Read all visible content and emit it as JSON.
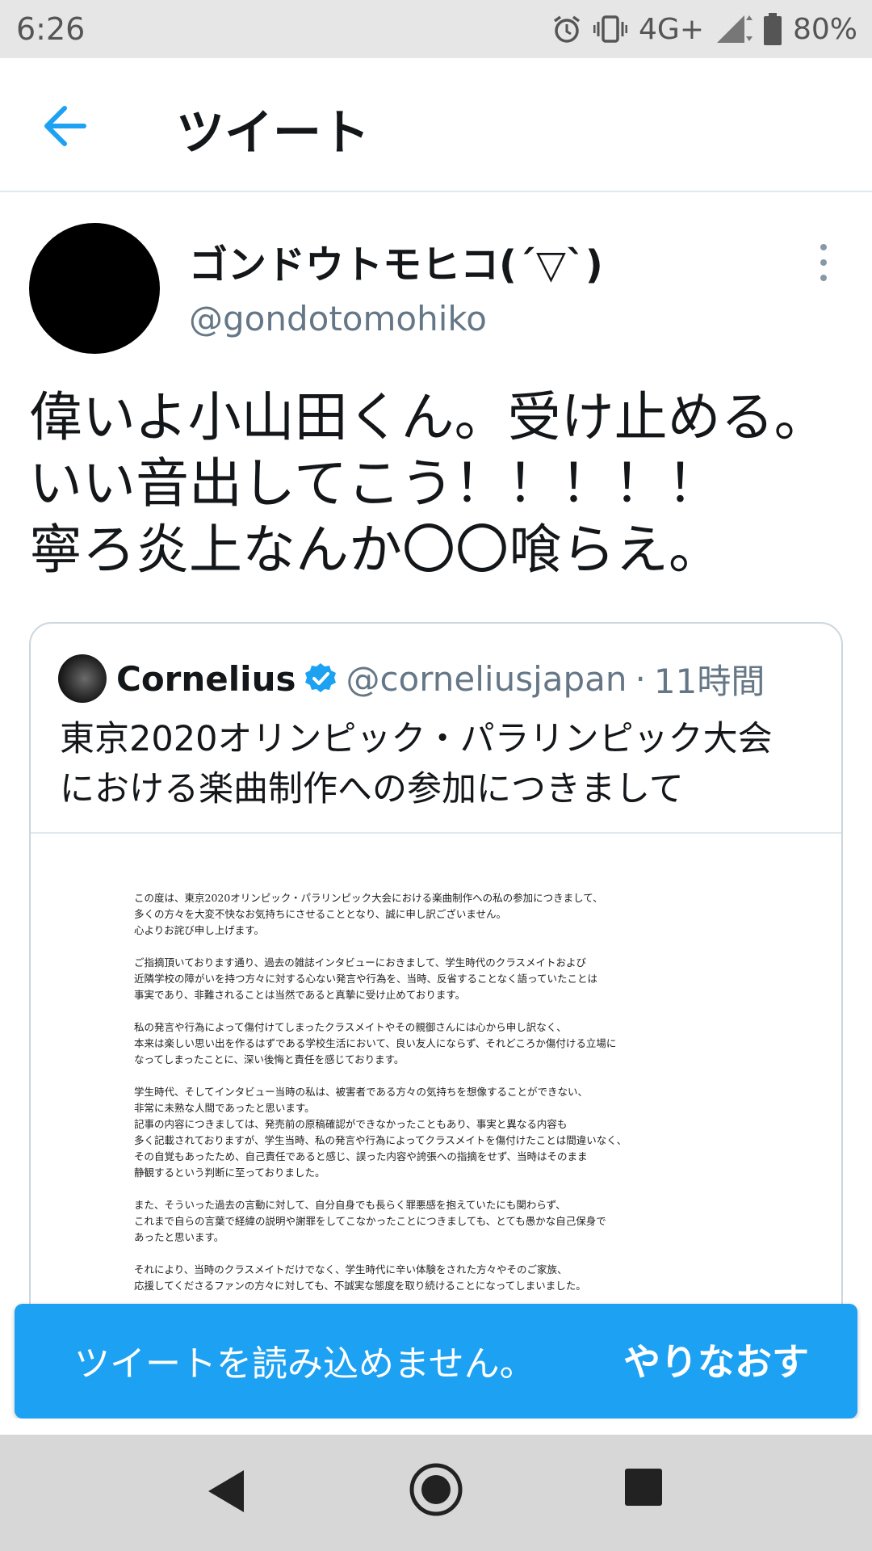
{
  "status_bar": {
    "time": "6:26",
    "network": "4G+",
    "battery": "80%",
    "icons": [
      "alarm-icon",
      "vibrate-icon",
      "signal-icon",
      "battery-icon"
    ]
  },
  "app_bar": {
    "title": "ツイート",
    "back_icon": "arrow-left-icon"
  },
  "tweet": {
    "author": {
      "display_name": "ゴンドウトモヒコ(´▽`)",
      "handle": "@gondotomohiko"
    },
    "text_lines": [
      "偉いよ小山田くん。受け止める。",
      "いい音出してこう！！！！！",
      "寧ろ炎上なんか〇〇喰らえ。"
    ],
    "more_icon": "more-vertical-icon",
    "quoted": {
      "name": "Cornelius",
      "verified_icon": "verified-badge-icon",
      "handle": "@corneliusjapan",
      "separator": "·",
      "time_ago": "11時間",
      "text_lines": [
        "東京2020オリンピック・パラリンピック大会",
        "における楽曲制作への参加につきまして"
      ],
      "document": {
        "paragraphs": [
          [
            "この度は、東京2020オリンピック・パラリンピック大会における楽曲制作への私の参加につきまして、",
            "多くの方々を大変不快なお気持ちにさせることとなり、誠に申し訳ございません。",
            "心よりお詫び申し上げます。"
          ],
          [
            "ご指摘頂いております通り、過去の雑誌インタビューにおきまして、学生時代のクラスメイトおよび",
            "近隣学校の障がいを持つ方々に対する心ない発言や行為を、当時、反省することなく語っていたことは",
            "事実であり、非難されることは当然であると真摯に受け止めております。"
          ],
          [
            "私の発言や行為によって傷付けてしまったクラスメイトやその親御さんには心から申し訳なく、",
            "本来は楽しい思い出を作るはずである学校生活において、良い友人にならず、それどころか傷付ける立場に",
            "なってしまったことに、深い後悔と責任を感じております。"
          ],
          [
            "学生時代、そしてインタビュー当時の私は、被害者である方々の気持ちを想像することができない、",
            "非常に未熟な人間であったと思います。",
            "記事の内容につきましては、発売前の原稿確認ができなかったこともあり、事実と異なる内容も",
            "多く記載されておりますが、学生当時、私の発言や行為によってクラスメイトを傷付けたことは間違いなく、",
            "その自覚もあったため、自己責任であると感じ、誤った内容や誇張への指摘をせず、当時はそのまま",
            "静観するという判断に至っておりました。"
          ],
          [
            "また、そういった過去の言動に対して、自分自身でも長らく罪悪感を抱えていたにも関わらず、",
            "これまで自らの言葉で経緯の説明や謝罪をしてこなかったことにつきましても、とても愚かな自己保身で",
            "あったと思います。"
          ],
          [
            "それにより、当時のクラスメイトだけでなく、学生時代に辛い体験をされた方々やそのご家族、",
            "応援してくださるファンの方々に対しても、不誠実な態度を取り続けることになってしまいました。"
          ]
        ]
      }
    }
  },
  "snackbar": {
    "message": "ツイートを読み込めません。",
    "action": "やりなおす"
  },
  "nav_bar": {
    "icons": [
      "back-triangle-icon",
      "home-circle-icon",
      "recents-square-icon"
    ]
  },
  "colors": {
    "accent": "#1da1f2",
    "text_primary": "#14171a",
    "text_secondary": "#657786",
    "border": "#ccd6dd",
    "status_bar_bg": "#e6e6e6",
    "nav_bar_bg": "#d7d7d7"
  }
}
